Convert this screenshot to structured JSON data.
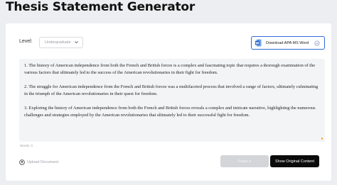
{
  "page": {
    "title": "Thesis Statement Generator"
  },
  "controls": {
    "level_label": "Level:",
    "level_value": "Undergraduate",
    "download_label": "Download APA MS Word"
  },
  "output": {
    "paragraphs": [
      "1. The history of American independence from both the French and British forces is a complex and fascinating topic that requires a thorough examination of the various factors that ultimately led to the success of the American revolutionaries in their fight for freedom.",
      "2. The struggle for American independence from the French and British forces was a multifaceted process that involved a range of factors, ultimately culminating in the triumph of the American revolutionaries in their quest for freedom.",
      "3. Exploring the history of American independence from both the French and British forces reveals a complex and intricate narrative, highlighting the numerous challenges and strategies employed by the American revolutionaries that ultimately led to their successful fight for freedom."
    ],
    "word_count": "Words: 0"
  },
  "footer": {
    "upload_label": "Upload Document",
    "ready_label": "Paste it",
    "show_original_label": "Show Original Content"
  },
  "colors": {
    "background": "#eceef1",
    "accent_blue": "#2f6bd8",
    "primary_button": "#0b0b0c",
    "disabled_button": "#d3d5d9"
  },
  "icons": {
    "word": "ms-word-icon",
    "download_status": "check-circle-icon",
    "select": "chevron-down-icon",
    "upload": "upload-icon"
  }
}
